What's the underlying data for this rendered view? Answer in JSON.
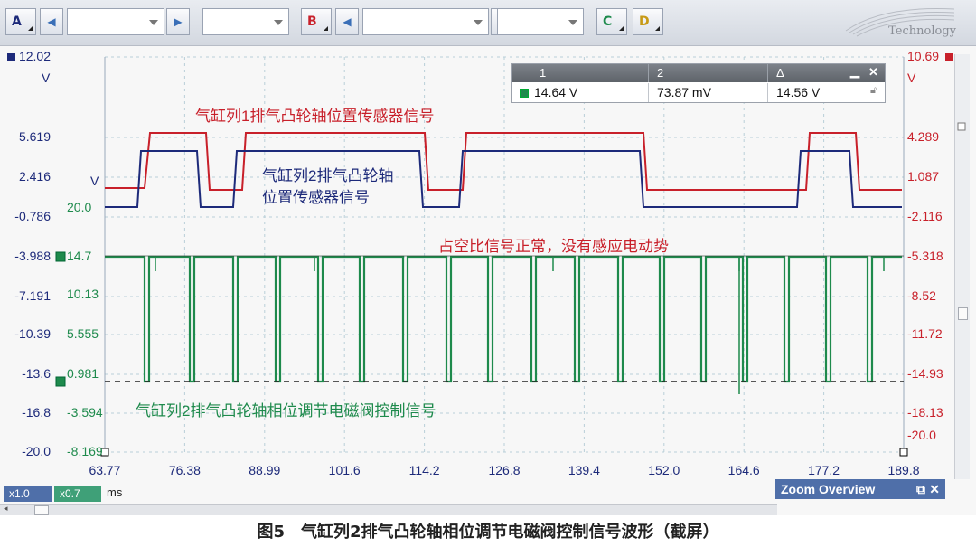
{
  "toolbar": {
    "channel_a": "A",
    "channel_b": "B",
    "channel_c": "C",
    "channel_d": "D",
    "logo_text": "Technology"
  },
  "left_axis_navy": {
    "unit": "V",
    "ticks": [
      "12.02",
      "5.619",
      "2.416",
      "-0.786",
      "-3.988",
      "-7.191",
      "-10.39",
      "-13.6",
      "-16.8",
      "-20.0"
    ]
  },
  "left_axis_green": {
    "unit": "V",
    "ticks": [
      "20.0",
      "14.7",
      "10.13",
      "5.555",
      "0.981",
      "-3.594",
      "-8.169"
    ]
  },
  "right_axis_red": {
    "unit": "V",
    "ticks": [
      "10.69",
      "4.289",
      "1.087",
      "-2.116",
      "-5.318",
      "-8.52",
      "-11.72",
      "-14.93",
      "-18.13",
      "-20.0"
    ]
  },
  "x_axis": {
    "unit": "ms",
    "ticks": [
      "63.77",
      "76.38",
      "88.99",
      "101.6",
      "114.2",
      "126.8",
      "139.4",
      "152.0",
      "164.6",
      "177.2",
      "189.8"
    ]
  },
  "cursor_panel": {
    "col1": "1",
    "col2": "2",
    "col3": "Δ",
    "val1": "14.64 V",
    "val2": "73.87 mV",
    "val3": "14.56 V"
  },
  "annotations": {
    "red_trace": "气缸列1排气凸轮轴位置传感器信号",
    "navy_trace_line1": "气缸列2排气凸轮轴",
    "navy_trace_line2": "位置传感器信号",
    "duty_note": "占空比信号正常，没有感应电动势",
    "green_trace": "气缸列2排气凸轮轴相位调节电磁阀控制信号"
  },
  "status": {
    "zoom_x1": "x1.0",
    "zoom_x2": "x0.7",
    "zoom_overview": "Zoom Overview"
  },
  "caption": "图5　气缸列2排气凸轮轴相位调节电磁阀控制信号波形（截屏）",
  "colors": {
    "red": "#c8202a",
    "navy": "#1d2a7a",
    "green": "#1e8a4c",
    "grid": "#b9cfd8"
  }
}
